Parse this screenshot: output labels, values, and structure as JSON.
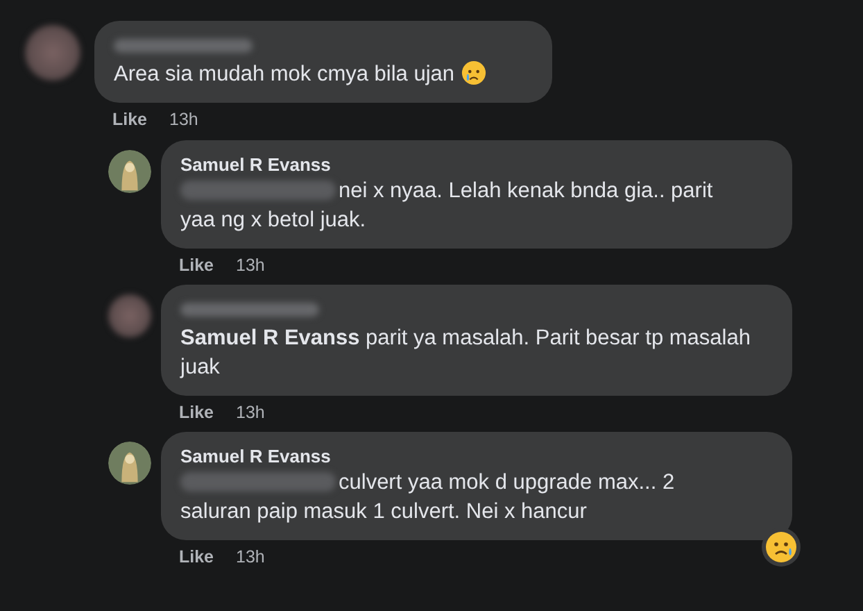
{
  "comments": [
    {
      "kind": "comment",
      "avatar_blurred": true,
      "mention_blurred": false,
      "text": "Area sia mudah mok cmya bila ujan",
      "emoji": true,
      "reaction": false,
      "like": "Like",
      "time": "13h"
    },
    {
      "kind": "reply",
      "avatar_blurred": false,
      "author": "Samuel R Evanss",
      "mention_blurred": true,
      "text": "nei x nyaa. Lelah kenak bnda gia.. parit yaa ng x betol juak.",
      "emoji": false,
      "reaction": false,
      "like": "Like",
      "time": "13h"
    },
    {
      "kind": "reply",
      "avatar_blurred": true,
      "mention_blurred": false,
      "text": "**Samuel R Evanss** parit ya masalah. Parit besar tp masalah juak",
      "emoji": false,
      "reaction": false,
      "like": "Like",
      "time": "13h"
    },
    {
      "kind": "reply",
      "avatar_blurred": false,
      "author": "Samuel R Evanss",
      "mention_blurred": true,
      "text": "culvert yaa mok d upgrade max... 2 saluran paip masuk 1 culvert. Nei x hancur",
      "emoji": false,
      "reaction": true,
      "like": "Like",
      "time": "13h"
    }
  ]
}
